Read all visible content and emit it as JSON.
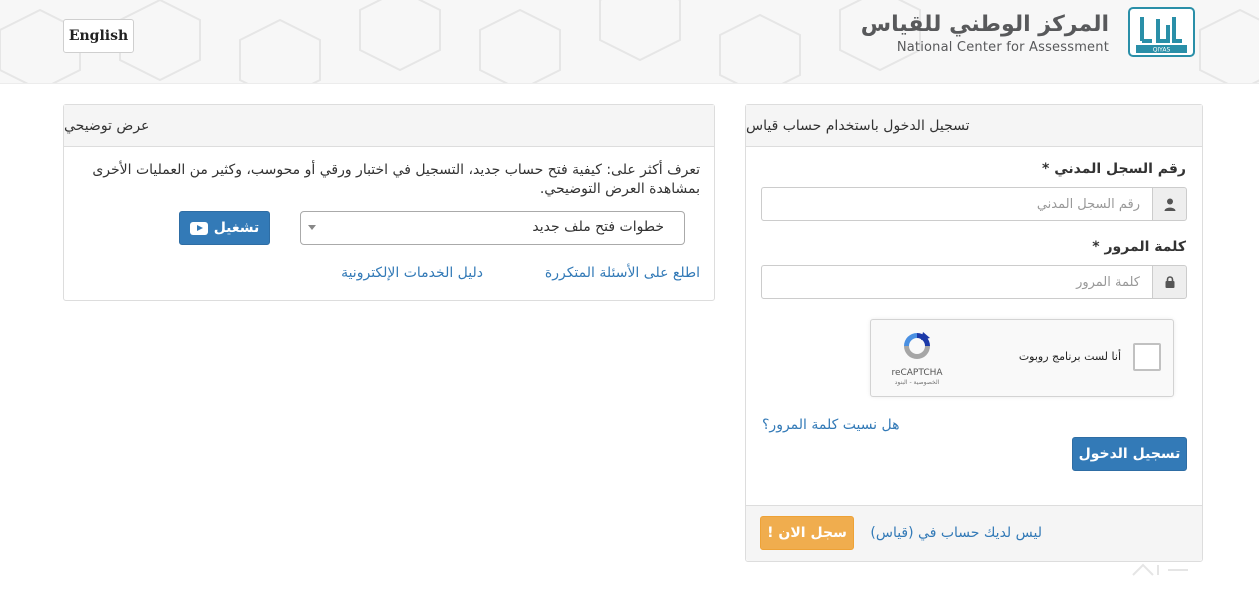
{
  "header": {
    "language_button": "English",
    "logo_ar": "المركز الوطني للقياس",
    "logo_en": "National Center for Assessment",
    "logo_mark": "QIYAS"
  },
  "login": {
    "title": "تسجيل الدخول باستخدام حساب قياس",
    "id_label": "رقم السجل المدني *",
    "id_placeholder": "رقم السجل المدني",
    "id_icon": "user-icon",
    "password_label": "كلمة المرور *",
    "password_placeholder": "كلمة المرور",
    "password_icon": "lock-icon",
    "recaptcha_label": "أنا لست برنامج روبوت",
    "recaptcha_brand": "reCAPTCHA",
    "recaptcha_links": "الخصوصية - البنود",
    "forgot_password": "هل نسيت كلمة المرور؟",
    "login_button": "تسجيل الدخول",
    "no_account_text": "ليس لديك حساب في (قياس)",
    "signup_button": "سجل الان !"
  },
  "demo": {
    "title": "عرض توضيحي",
    "description": "تعرف أكثر على: كيفية فتح حساب جديد، التسجيل في اختبار ورقي أو محوسب، وكثير من العمليات الأخرى بمشاهدة العرض التوضيحي.",
    "select_value": "خطوات فتح ملف جديد",
    "play_button": "تشغيل",
    "faq_link": "اطلع على الأسئلة المتكررة",
    "services_link": "دليل الخدمات الإلكترونية"
  },
  "colors": {
    "primary": "#337ab7",
    "warning": "#f0ad4e",
    "logo_teal": "#2a8fa8",
    "logo_gray": "#58595b"
  }
}
